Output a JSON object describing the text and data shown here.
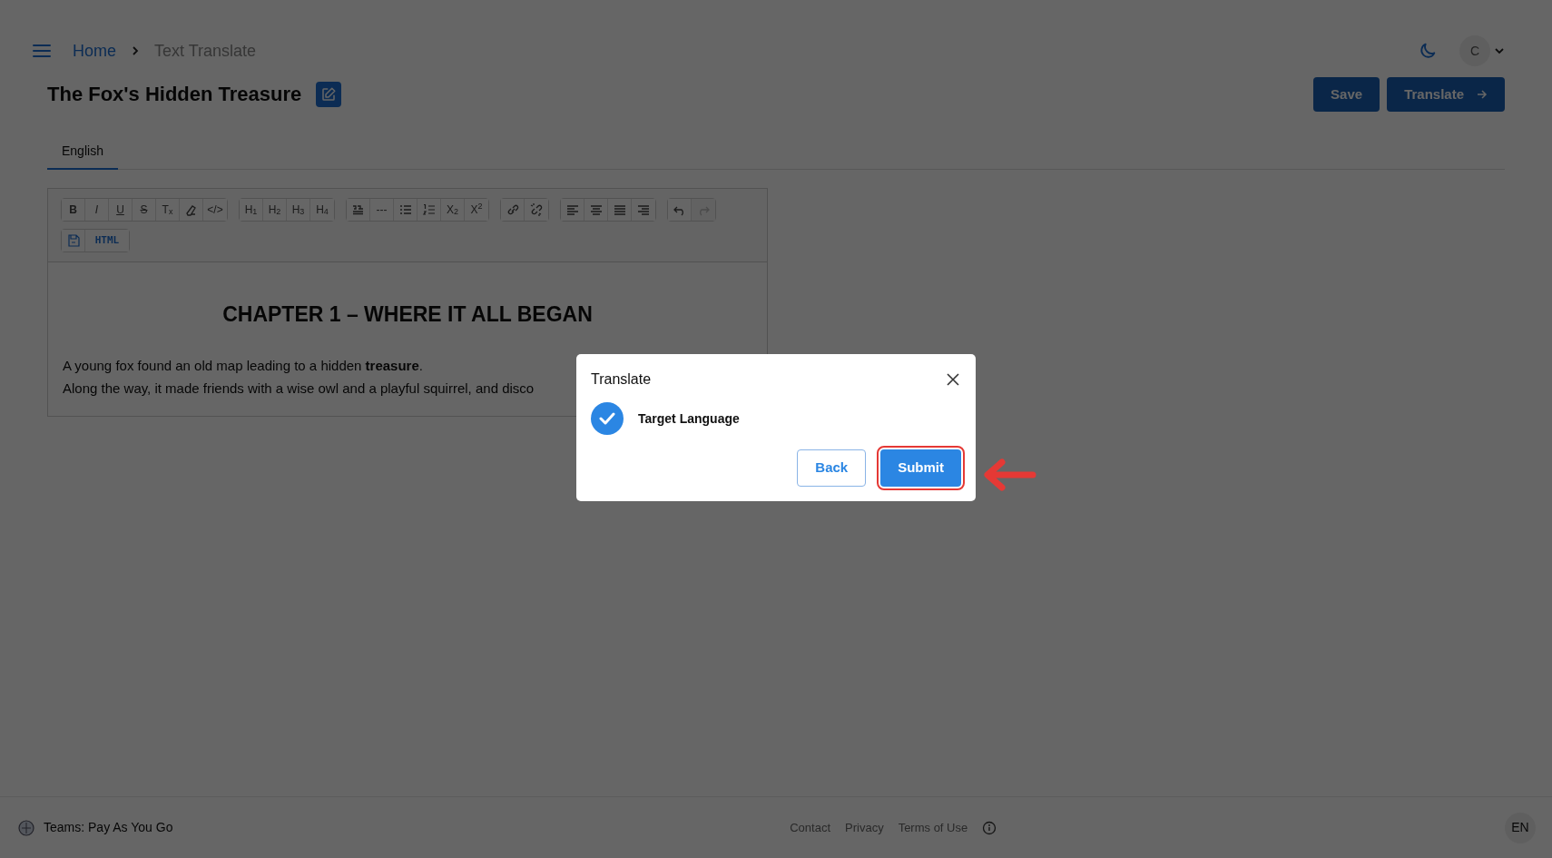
{
  "breadcrumb": [
    {
      "label": "Home",
      "current": false
    },
    {
      "label": "Text Translate",
      "current": true
    }
  ],
  "header": {
    "avatar": "C"
  },
  "document": {
    "title": "The Fox's Hidden Treasure"
  },
  "actions": [
    "Save",
    "Translate"
  ],
  "tabs": [
    {
      "label": "English",
      "selected": true
    }
  ],
  "toolbar": [
    [
      {
        "kind": "bold",
        "label": "B"
      },
      {
        "kind": "italic",
        "label": "I"
      },
      {
        "kind": "underline",
        "label": "U"
      },
      {
        "kind": "strike",
        "label": "S"
      },
      {
        "kind": "text",
        "label": "T$_{x}$"
      },
      {
        "kind": "highlight"
      },
      {
        "kind": "text",
        "label": "</>"
      }
    ],
    [
      {
        "kind": "text",
        "label": "H$_{1}$"
      },
      {
        "kind": "text",
        "label": "H$_{2}$"
      },
      {
        "kind": "text",
        "label": "H$_{3}$"
      },
      {
        "kind": "text",
        "label": "H$_{4}$"
      }
    ],
    [
      {
        "kind": "quote"
      },
      {
        "kind": "text",
        "label": "---"
      },
      {
        "kind": "bullets"
      },
      {
        "kind": "numbers"
      },
      {
        "kind": "text",
        "label": "X$_{2}$"
      },
      {
        "kind": "text",
        "label": "X$^{2}$"
      }
    ],
    [
      {
        "kind": "link"
      },
      {
        "kind": "unlink"
      }
    ],
    [
      {
        "kind": "align-left"
      },
      {
        "kind": "align-center"
      },
      {
        "kind": "align-justify"
      },
      {
        "kind": "align-right"
      }
    ],
    [
      {
        "kind": "undo",
        "disabled": false
      },
      {
        "kind": "redo",
        "disabled": true
      }
    ],
    [
      {
        "kind": "save"
      },
      {
        "kind": "html",
        "label": "HTML"
      }
    ]
  ],
  "content": {
    "heading": "CHAPTER 1 – WHERE IT ALL BEGAN",
    "paragraphs": [
      "A young fox found an old map leading to a hidden **treasure**.",
      "Along the way, it made friends with a wise owl and a playful squirrel, and disco"
    ]
  },
  "dialog": {
    "title": "Translate",
    "steps": [
      {
        "label": "Target Language",
        "checked": true
      }
    ],
    "buttons": [
      {
        "label": "Back",
        "kind": "secondary"
      },
      {
        "label": "Submit",
        "kind": "primary",
        "highlighted": true
      }
    ]
  },
  "footer": {
    "plan": "Teams: Pay As You Go",
    "links": [
      "Contact",
      "Privacy",
      "Terms of Use"
    ],
    "language": "EN"
  }
}
